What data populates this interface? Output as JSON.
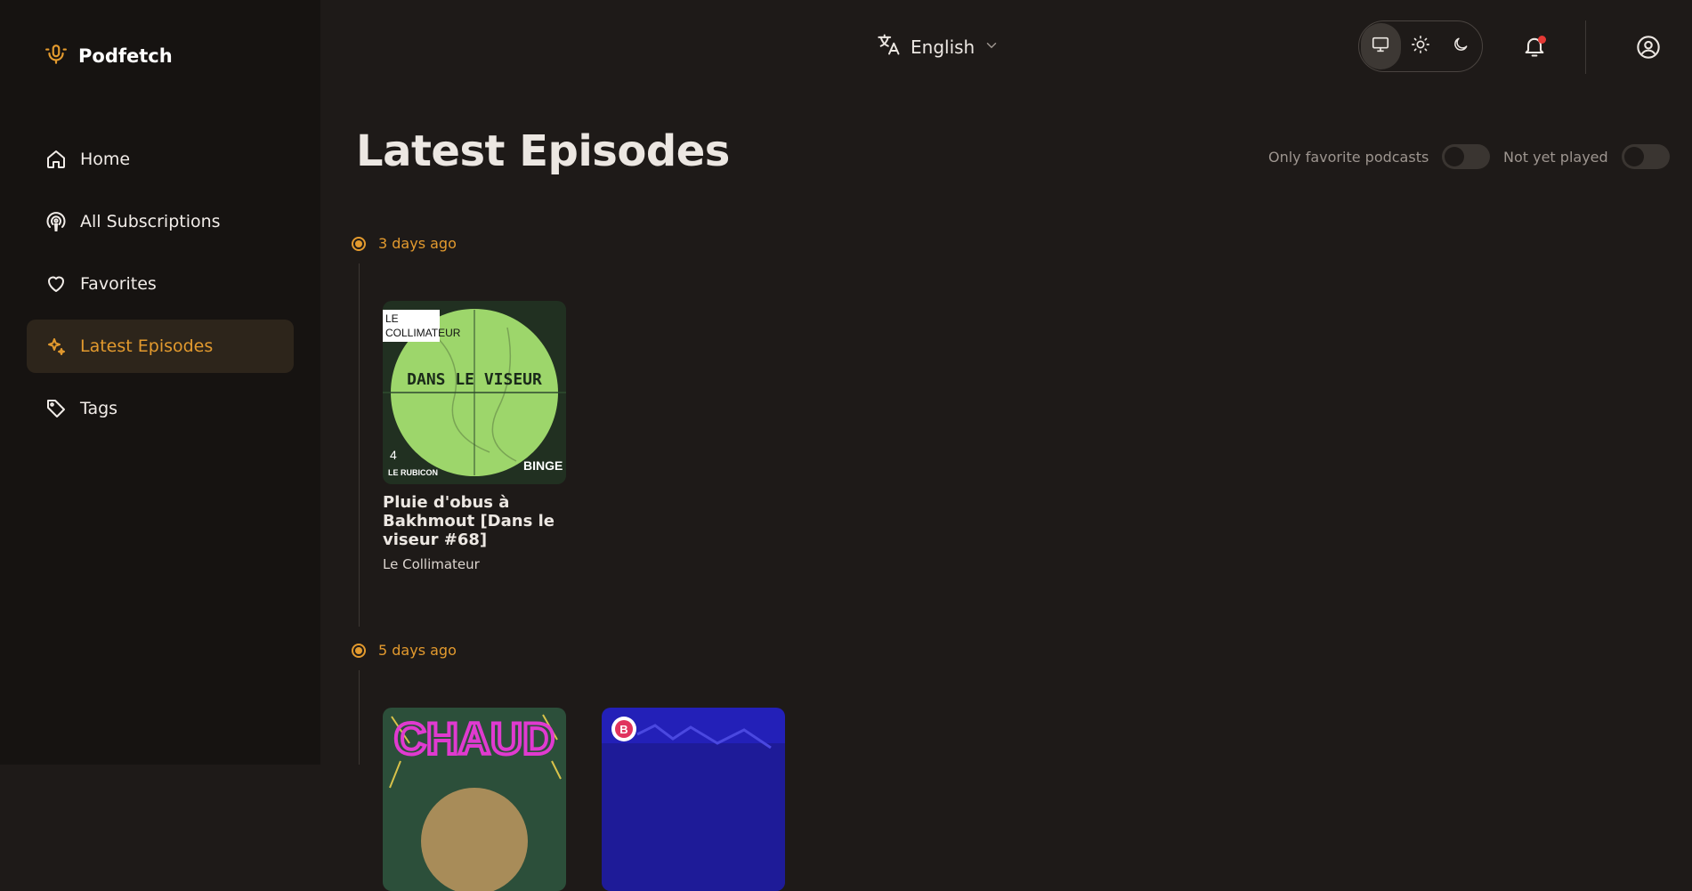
{
  "app": {
    "name": "Podfetch"
  },
  "sidebar": {
    "items": [
      {
        "label": "Home",
        "icon": "home-icon",
        "active": false
      },
      {
        "label": "All Subscriptions",
        "icon": "podcast-icon",
        "active": false
      },
      {
        "label": "Favorites",
        "icon": "heart-icon",
        "active": false
      },
      {
        "label": "Latest Episodes",
        "icon": "sparkles-icon",
        "active": true
      },
      {
        "label": "Tags",
        "icon": "tag-icon",
        "active": false
      }
    ]
  },
  "header": {
    "language": "English",
    "theme_options": [
      "system",
      "light",
      "dark"
    ],
    "theme_selected": "system",
    "has_notifications": true
  },
  "main": {
    "title": "Latest Episodes",
    "filters": {
      "only_favorites": {
        "label": "Only favorite podcasts",
        "on": false
      },
      "not_yet_played": {
        "label": "Not yet played",
        "on": false
      }
    },
    "groups": [
      {
        "date": "3 days ago",
        "episodes": [
          {
            "title": "Pluie d'obus à Bakhmout [Dans le viseur #68]",
            "podcast": "Le Collimateur",
            "cover": {
              "brand_line1": "LE",
              "brand_line2": "COLLIMATEUR",
              "show": "DANS LE VISEUR",
              "badge_number": "4",
              "partner": "LE RUBICON",
              "network": "BINGE"
            }
          }
        ]
      },
      {
        "date": "5 days ago",
        "episodes": [
          {
            "title": "",
            "podcast": "",
            "cover": {
              "text": "CHAUD"
            }
          },
          {
            "title": "",
            "podcast": "",
            "cover": {
              "badge": "B"
            }
          }
        ]
      }
    ]
  },
  "colors": {
    "accent": "#e39a2e",
    "background": "#1e1a18",
    "sidebar": "#161311",
    "notification_dot": "#e53935"
  }
}
